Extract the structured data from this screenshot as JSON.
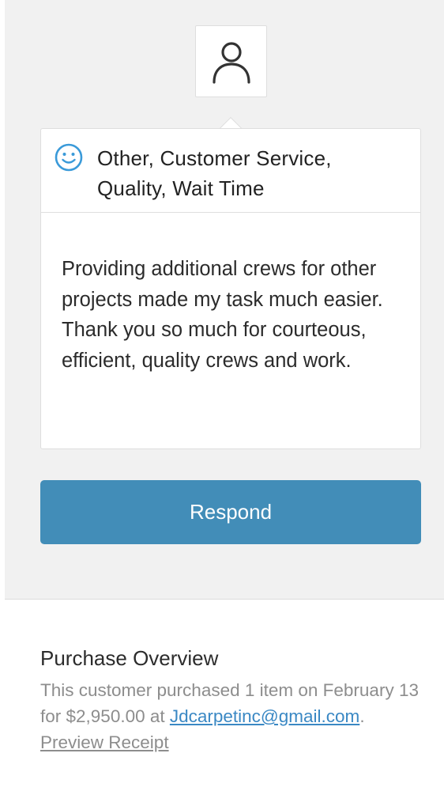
{
  "review": {
    "avatar_icon": "user-outline-icon",
    "sentiment_icon": "smiley-icon",
    "sentiment_color": "#3a9ad9",
    "categories": "Other, Customer Service, Quality, Wait Time",
    "body": "Providing additional crews for other projects made my task much easier. Thank you so much for courteous, efficient, quality crews and work."
  },
  "actions": {
    "respond_label": "Respond",
    "respond_color": "#428db8"
  },
  "purchase_overview": {
    "title": "Purchase Overview",
    "text_before": "This customer purchased 1 item on February 13 for $2,950.00 at ",
    "email": "Jdcarpetinc@gmail.com",
    "separator": ". ",
    "preview_label": "Preview Receipt",
    "link_color": "#3a88c4"
  }
}
